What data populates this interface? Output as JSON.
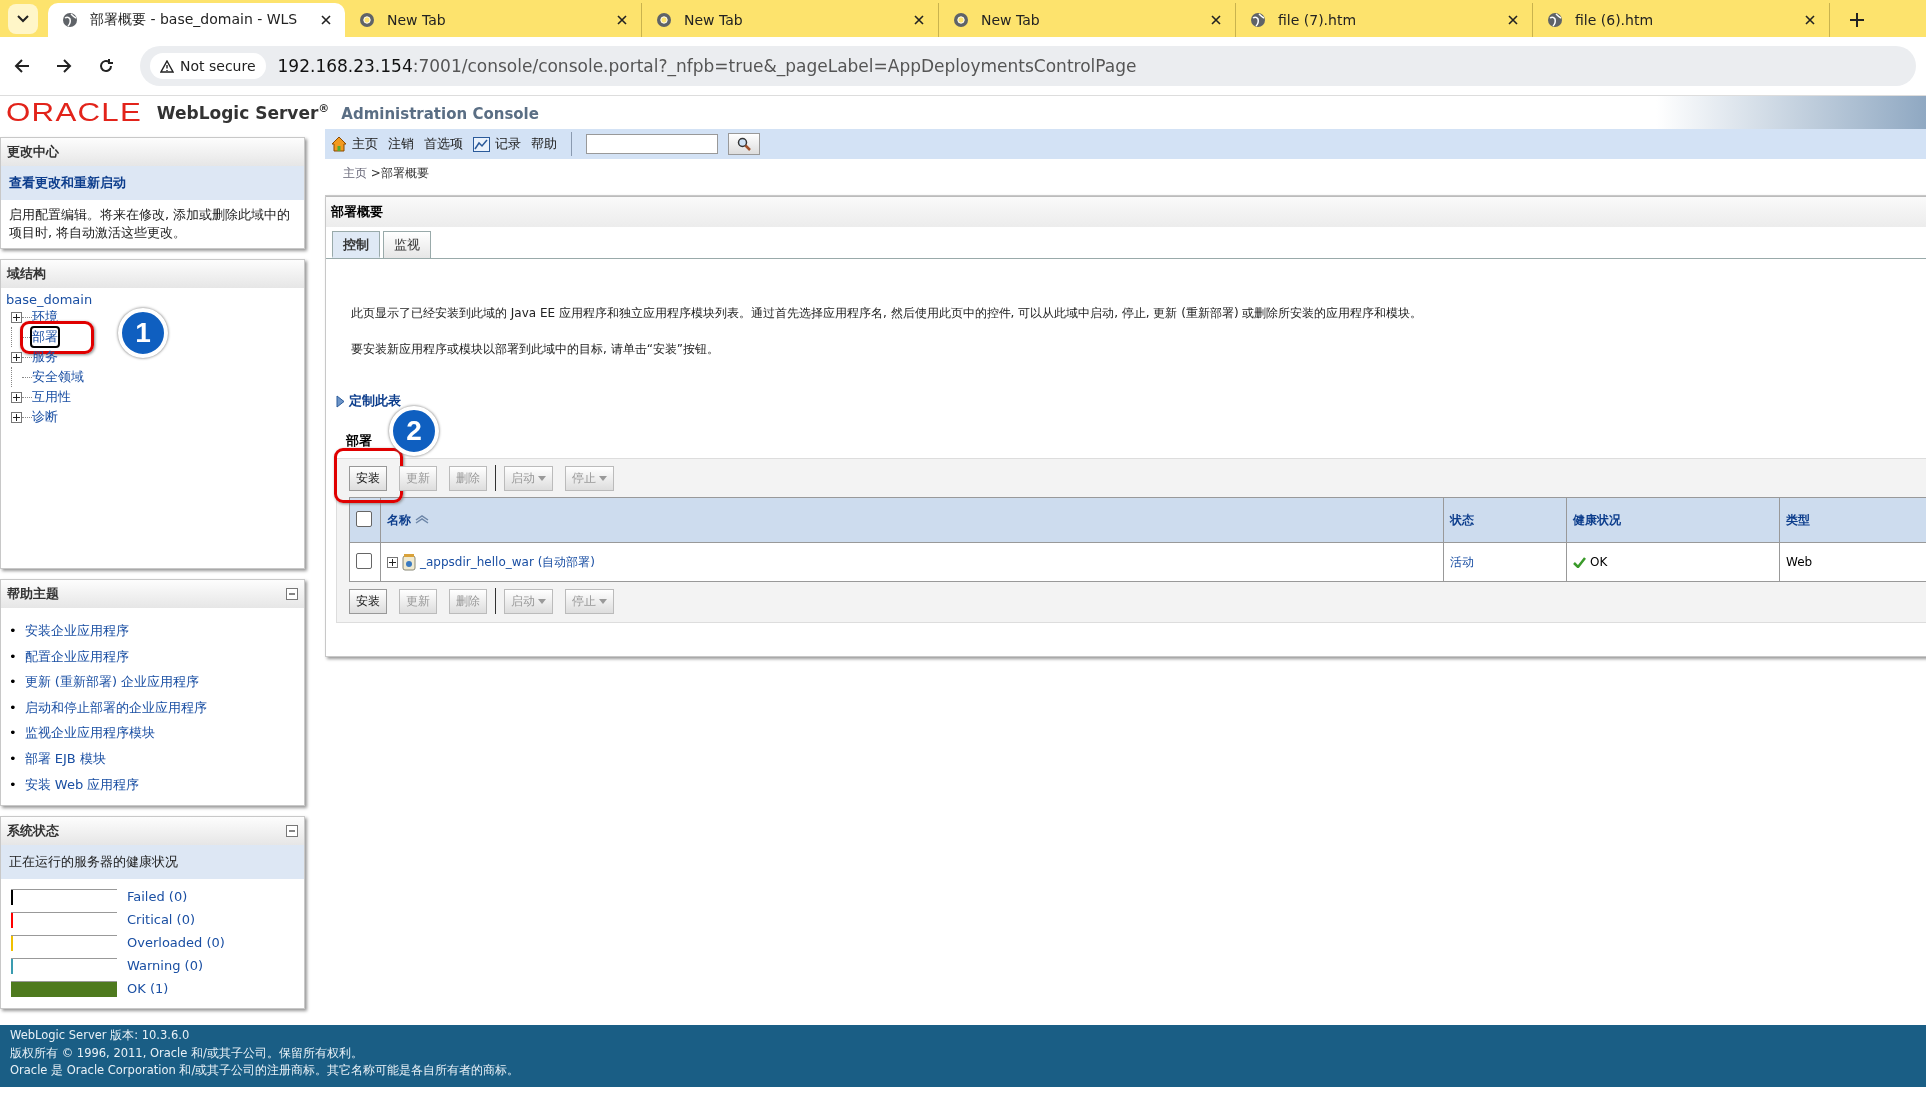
{
  "browser": {
    "tabs": [
      {
        "title": "部署概要 - base_domain - WLS",
        "kind": "globe",
        "selected": true
      },
      {
        "title": "New Tab",
        "kind": "chrome",
        "selected": false
      },
      {
        "title": "New Tab",
        "kind": "chrome",
        "selected": false
      },
      {
        "title": "New Tab",
        "kind": "chrome",
        "selected": false
      },
      {
        "title": "file (7).htm",
        "kind": "globe",
        "selected": false
      },
      {
        "title": "file (6).htm",
        "kind": "globe",
        "selected": false
      }
    ],
    "security": "Not secure",
    "url_host": "192.168.23.154",
    "url_rest": ":7001/console/console.portal?_nfpb=true&_pageLabel=AppDeploymentsControlPage"
  },
  "header": {
    "logo": "ORACLE",
    "product": "WebLogic Server",
    "reg": "®",
    "subtitle": "Administration Console"
  },
  "change_center": {
    "title": "更改中心",
    "link": "查看更改和重新启动",
    "text": "启用配置编辑。将来在修改, 添加或删除此域中的项目时, 将自动激活这些更改。"
  },
  "domain_structure": {
    "title": "域结构",
    "root": "base_domain",
    "children": [
      {
        "label": "环境",
        "kind": "branch",
        "selected": false
      },
      {
        "label": "部署",
        "kind": "leaf",
        "selected": true,
        "callout": "1"
      },
      {
        "label": "服务",
        "kind": "branch",
        "selected": false
      },
      {
        "label": "安全领域",
        "kind": "leaf",
        "selected": false
      },
      {
        "label": "互用性",
        "kind": "branch",
        "selected": false
      },
      {
        "label": "诊断",
        "kind": "branch",
        "selected": false
      }
    ]
  },
  "help_topics": {
    "title": "帮助主题",
    "bullet": "•",
    "items": [
      "安装企业应用程序",
      "配置企业应用程序",
      "更新 (重新部署) 企业应用程序",
      "启动和停止部署的企业应用程序",
      "监视企业应用程序模块",
      "部署 EJB 模块",
      "安装 Web 应用程序"
    ]
  },
  "system_status": {
    "title": "系统状态",
    "subtitle": "正在运行的服务器的健康状况",
    "rows": [
      {
        "label": "Failed (0)",
        "color": "#000000",
        "level": 0
      },
      {
        "label": "Critical (0)",
        "color": "#ff0000",
        "level": 0
      },
      {
        "label": "Overloaded (0)",
        "color": "#f0c000",
        "level": 0
      },
      {
        "label": "Warning (0)",
        "color": "#3a9cb0",
        "level": 0
      },
      {
        "label": "OK (1)",
        "color": "#4e7a1e",
        "level": 1
      }
    ]
  },
  "toolbar": {
    "items": [
      {
        "label": "主页",
        "kind": "home"
      },
      {
        "label": "注销",
        "kind": "text"
      },
      {
        "label": "首选项",
        "kind": "text"
      },
      {
        "label": "记录",
        "kind": "chart"
      },
      {
        "label": "帮助",
        "kind": "text"
      }
    ]
  },
  "breadcrumb": {
    "link": "主页",
    "current": " >部署概要"
  },
  "content": {
    "title": "部署概要",
    "tabs": [
      {
        "label": "控制",
        "selected": true
      },
      {
        "label": "监视",
        "selected": false
      }
    ],
    "description": "此页显示了已经安装到此域的 Java EE 应用程序和独立应用程序模块列表。通过首先选择应用程序名, 然后使用此页中的控件, 可以从此域中启动, 停止, 更新 (重新部署) 或删除所安装的应用程序和模块。",
    "install_hint": "要安装新应用程序或模块以部署到此域中的目标, 请单击“安装”按钮。",
    "customize": "定制此表",
    "table_title": "部署",
    "buttons_top": [
      {
        "label": "安装",
        "disabled": false,
        "dropdown": false,
        "callout": "2"
      },
      {
        "label": "更新",
        "disabled": true,
        "dropdown": false
      },
      {
        "label": "删除",
        "disabled": true,
        "dropdown": false
      },
      {
        "label": "启动",
        "disabled": true,
        "dropdown": true
      },
      {
        "label": "停止",
        "disabled": true,
        "dropdown": true
      }
    ],
    "buttons_bottom": [
      {
        "label": "安装",
        "disabled": false,
        "dropdown": false
      },
      {
        "label": "更新",
        "disabled": true,
        "dropdown": false
      },
      {
        "label": "删除",
        "disabled": true,
        "dropdown": false
      },
      {
        "label": "启动",
        "disabled": true,
        "dropdown": true
      },
      {
        "label": "停止",
        "disabled": true,
        "dropdown": true
      }
    ],
    "table": {
      "select_all": {
        "checked": false
      },
      "columns": [
        "名称",
        "状态",
        "健康状况",
        "类型"
      ],
      "rows": [
        {
          "checked": false,
          "expanded": false,
          "name": "_appsdir_hello_war (自动部署)",
          "state": "活动",
          "health": "OK",
          "type": "Web"
        }
      ]
    }
  },
  "footer": {
    "lines": [
      "WebLogic Server 版本: 10.3.6.0",
      "版权所有 © 1996, 2011, Oracle 和/或其子公司。保留所有权利。",
      "Oracle 是 Oracle Corporation 和/或其子公司的注册商标。其它名称可能是各自所有者的商标。"
    ]
  }
}
